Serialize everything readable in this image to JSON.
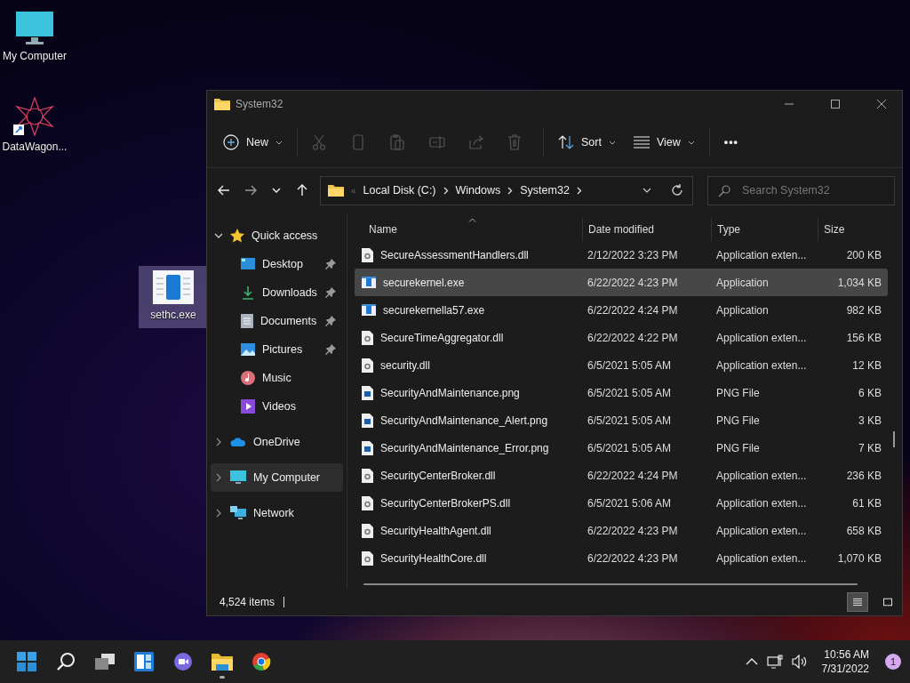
{
  "desktop_icons": [
    {
      "label": "My Computer",
      "kind": "monitor",
      "selected": false
    },
    {
      "label": "DataWagon...",
      "kind": "shortcut",
      "selected": false
    },
    {
      "label": "sethc.exe",
      "kind": "exe",
      "selected": true
    }
  ],
  "window": {
    "title": "System32",
    "toolbar": [
      {
        "kind": "new",
        "label": "New",
        "disabled": false
      },
      {
        "kind": "cut",
        "disabled": true
      },
      {
        "kind": "copy",
        "disabled": true
      },
      {
        "kind": "paste",
        "disabled": true
      },
      {
        "kind": "rename",
        "disabled": true
      },
      {
        "kind": "share",
        "disabled": true
      },
      {
        "kind": "delete",
        "disabled": true
      },
      {
        "kind": "sort",
        "label": "Sort",
        "disabled": false
      },
      {
        "kind": "view",
        "label": "View",
        "disabled": false
      },
      {
        "kind": "more",
        "label": "•••",
        "disabled": false
      }
    ],
    "nav": [
      {
        "kind": "back",
        "disabled": false
      },
      {
        "kind": "forward",
        "disabled": true
      },
      {
        "kind": "recent",
        "disabled": false
      },
      {
        "kind": "up",
        "disabled": false
      }
    ],
    "address": {
      "overflow": "«",
      "segments": [
        "Local Disk (C:)",
        "Windows",
        "System32"
      ]
    },
    "search": {
      "placeholder": "Search System32"
    },
    "sidebar": [
      {
        "label": "Quick access",
        "kind": "star",
        "expanded": true,
        "selected": false,
        "children": [
          {
            "label": "Desktop",
            "kind": "desktop",
            "pinned": true,
            "selected": false
          },
          {
            "label": "Downloads",
            "kind": "download",
            "pinned": true,
            "selected": false
          },
          {
            "label": "Documents",
            "kind": "document",
            "pinned": true,
            "selected": false
          },
          {
            "label": "Pictures",
            "kind": "picture",
            "pinned": true,
            "selected": false
          },
          {
            "label": "Music",
            "kind": "music",
            "pinned": false,
            "selected": false
          },
          {
            "label": "Videos",
            "kind": "video",
            "pinned": false,
            "selected": false
          }
        ]
      },
      {
        "label": "OneDrive",
        "kind": "cloud",
        "expanded": false,
        "selected": false
      },
      {
        "label": "My Computer",
        "kind": "monitor",
        "expanded": false,
        "selected": true
      },
      {
        "label": "Network",
        "kind": "network",
        "expanded": false,
        "selected": false
      }
    ],
    "columns": [
      {
        "label": "Name",
        "sorted": true
      },
      {
        "label": "Date modified",
        "sorted": false
      },
      {
        "label": "Type",
        "sorted": false
      },
      {
        "label": "Size",
        "sorted": false
      }
    ],
    "rows": [
      {
        "name": "SecureAssessmentHandlers.dll",
        "kind": "dll",
        "date": "2/12/2022 3:23 PM",
        "type": "Application exten...",
        "size": "200 KB",
        "selected": false
      },
      {
        "name": "securekernel.exe",
        "kind": "exe",
        "date": "6/22/2022 4:23 PM",
        "type": "Application",
        "size": "1,034 KB",
        "selected": true
      },
      {
        "name": "securekernella57.exe",
        "kind": "exe",
        "date": "6/22/2022 4:24 PM",
        "type": "Application",
        "size": "982 KB",
        "selected": false
      },
      {
        "name": "SecureTimeAggregator.dll",
        "kind": "dll",
        "date": "6/22/2022 4:22 PM",
        "type": "Application exten...",
        "size": "156 KB",
        "selected": false
      },
      {
        "name": "security.dll",
        "kind": "dll",
        "date": "6/5/2021 5:05 AM",
        "type": "Application exten...",
        "size": "12 KB",
        "selected": false
      },
      {
        "name": "SecurityAndMaintenance.png",
        "kind": "png",
        "date": "6/5/2021 5:05 AM",
        "type": "PNG File",
        "size": "6 KB",
        "selected": false
      },
      {
        "name": "SecurityAndMaintenance_Alert.png",
        "kind": "png",
        "date": "6/5/2021 5:05 AM",
        "type": "PNG File",
        "size": "3 KB",
        "selected": false
      },
      {
        "name": "SecurityAndMaintenance_Error.png",
        "kind": "png",
        "date": "6/5/2021 5:05 AM",
        "type": "PNG File",
        "size": "7 KB",
        "selected": false
      },
      {
        "name": "SecurityCenterBroker.dll",
        "kind": "dll",
        "date": "6/22/2022 4:24 PM",
        "type": "Application exten...",
        "size": "236 KB",
        "selected": false
      },
      {
        "name": "SecurityCenterBrokerPS.dll",
        "kind": "dll",
        "date": "6/5/2021 5:06 AM",
        "type": "Application exten...",
        "size": "61 KB",
        "selected": false
      },
      {
        "name": "SecurityHealthAgent.dll",
        "kind": "dll",
        "date": "6/22/2022 4:23 PM",
        "type": "Application exten...",
        "size": "658 KB",
        "selected": false
      },
      {
        "name": "SecurityHealthCore.dll",
        "kind": "dll",
        "date": "6/22/2022 4:23 PM",
        "type": "Application exten...",
        "size": "1,070 KB",
        "selected": false
      }
    ],
    "status": "4,524 items",
    "views": [
      {
        "kind": "details",
        "selected": true
      },
      {
        "kind": "preview",
        "selected": false
      }
    ]
  },
  "taskbar": {
    "apps": [
      {
        "kind": "start",
        "running": false
      },
      {
        "kind": "search",
        "running": false
      },
      {
        "kind": "taskview",
        "running": false
      },
      {
        "kind": "widgets",
        "running": false
      },
      {
        "kind": "chat",
        "running": false
      },
      {
        "kind": "explorer",
        "running": true
      },
      {
        "kind": "browser",
        "running": false
      }
    ],
    "time": "10:56 AM",
    "date": "7/31/2022",
    "notifications": "1"
  }
}
